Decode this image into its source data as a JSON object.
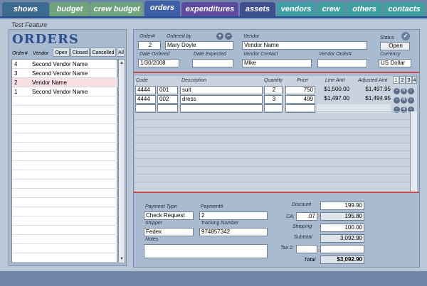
{
  "tabs": [
    {
      "label": "shows",
      "color": "#3d6a8f",
      "active": false
    },
    {
      "label": "budget",
      "color": "#6fa37d",
      "active": false
    },
    {
      "label": "crew budget",
      "color": "#6fa37d",
      "active": false
    },
    {
      "label": "orders",
      "color": "#3d5fa8",
      "active": true
    },
    {
      "label": "expenditures",
      "color": "#5d4a9e",
      "active": false
    },
    {
      "label": "assets",
      "color": "#3d4f8e",
      "active": false
    },
    {
      "label": "vendors",
      "color": "#3f9ea3",
      "active": false
    },
    {
      "label": "crew",
      "color": "#3f9e9e",
      "active": false
    },
    {
      "label": "others",
      "color": "#3f9e9e",
      "active": false
    },
    {
      "label": "contacts",
      "color": "#3f9e9e",
      "active": false
    }
  ],
  "feature_title": "Test Feature",
  "left_panel": {
    "logo": "ORDERS",
    "col_order": "Order#",
    "col_vendor": "Vendor",
    "filters": [
      "Open",
      "Closed",
      "Cancelled",
      "All"
    ],
    "orders": [
      {
        "num": "4",
        "vendor": "Second Vendor Name",
        "selected": false
      },
      {
        "num": "3",
        "vendor": "Second Vendor Name",
        "selected": false
      },
      {
        "num": "2",
        "vendor": "Vendor Name",
        "selected": true
      },
      {
        "num": "1",
        "vendor": "Second Vendor Name",
        "selected": false
      }
    ]
  },
  "header": {
    "order_label": "Order#",
    "order_value": "2",
    "ordered_by_label": "Ordered by",
    "ordered_by_value": "Mary Doyle",
    "vendor_label": "Vendor",
    "vendor_value": "Vendor Name",
    "status_label": "Status",
    "status_value": "Open",
    "date_ordered_label": "Date Ordered",
    "date_ordered_value": "1/30/2008",
    "date_expected_label": "Date Expected",
    "date_expected_value": "",
    "vendor_contact_label": "Vendor Contact",
    "vendor_contact_value": "Mike",
    "vendor_order_label": "Vendor Order#",
    "vendor_order_value": "",
    "currency_label": "Currency",
    "currency_value": "US Dollar"
  },
  "lines": {
    "headers": {
      "code": "Code",
      "description": "Description",
      "quantity": "Quantity",
      "price": "Price",
      "line_amt": "Line Amt",
      "adjusted_amt": "Adjusted Amt"
    },
    "pages": [
      "1",
      "2",
      "3",
      "4"
    ],
    "rows": [
      {
        "code": "4444",
        "sub": "001",
        "description": "suit",
        "quantity": "2",
        "price": "750",
        "line_amt": "$1,500.00",
        "adjusted_amt": "$1,497.95"
      },
      {
        "code": "4444",
        "sub": "002",
        "description": "dress",
        "quantity": "3",
        "price": "499",
        "line_amt": "$1,497.00",
        "adjusted_amt": "$1,494.95"
      },
      {
        "code": "",
        "sub": "",
        "description": "",
        "quantity": "",
        "price": "",
        "line_amt": "",
        "adjusted_amt": ""
      }
    ]
  },
  "footer": {
    "payment_type_label": "Payment Type",
    "payment_type_value": "Check Request",
    "payment_num_label": "Payment#",
    "payment_num_value": "2",
    "shipper_label": "Shipper",
    "shipper_value": "Fedex",
    "tracking_label": "Tracking  Number",
    "tracking_value": "974857342",
    "notes_label": "Notes",
    "notes_value": ""
  },
  "totals": {
    "discount_label": "Discount",
    "discount_value": "199.90",
    "ca_label": "CA:",
    "ca_rate": ".07",
    "ca_value": "195.80",
    "shipping_label": "Shipping",
    "shipping_value": "100.00",
    "subtotal_label": "Subtotal",
    "subtotal_value": "3,092.90",
    "tax2_label": "Tax 2:",
    "tax2_rate": "",
    "tax2_value": "",
    "total_label": "Total",
    "total_value": "$3,092.90"
  },
  "icons": {
    "add": "+",
    "remove": "−",
    "check": "✓",
    "row_delete": "−",
    "row_reorder": "R",
    "row_info": "i"
  }
}
